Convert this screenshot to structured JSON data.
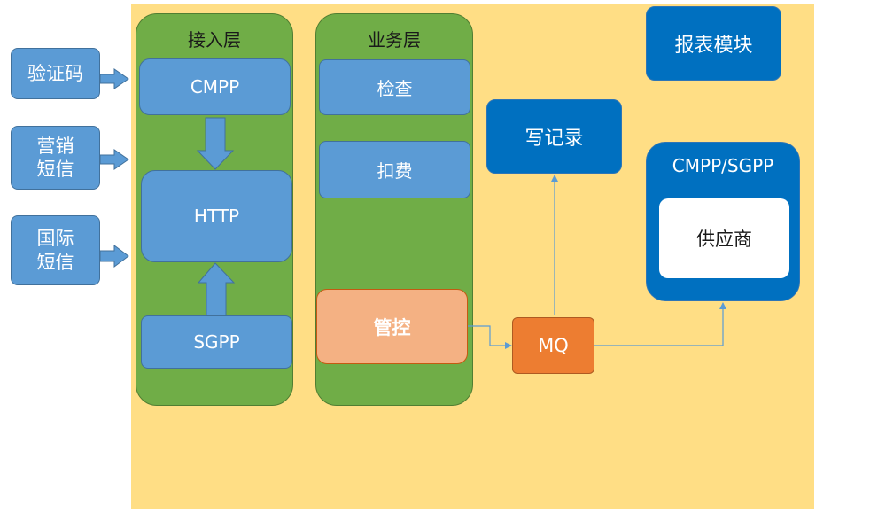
{
  "inputs": [
    {
      "label": "验证码"
    },
    {
      "label": "营销\n短信"
    },
    {
      "label": "国际\n短信"
    }
  ],
  "access_layer": {
    "title": "接入层",
    "nodes": [
      "CMPP",
      "HTTP",
      "SGPP"
    ]
  },
  "business_layer": {
    "title": "业务层",
    "nodes": [
      "检查",
      "扣费",
      "管控"
    ]
  },
  "report_module": "报表模块",
  "write_record": "写记录",
  "mq": "MQ",
  "supplier_group": {
    "title": "CMPP/SGPP",
    "supplier": "供应商"
  },
  "colors": {
    "background": "#FFDE85",
    "layer_green": "#70AD47",
    "node_blue": "#5B9BD5",
    "dark_blue": "#0070C0",
    "peach": "#F4B183",
    "mq_orange": "#ED7D31",
    "connector": "#5B9BD5"
  }
}
